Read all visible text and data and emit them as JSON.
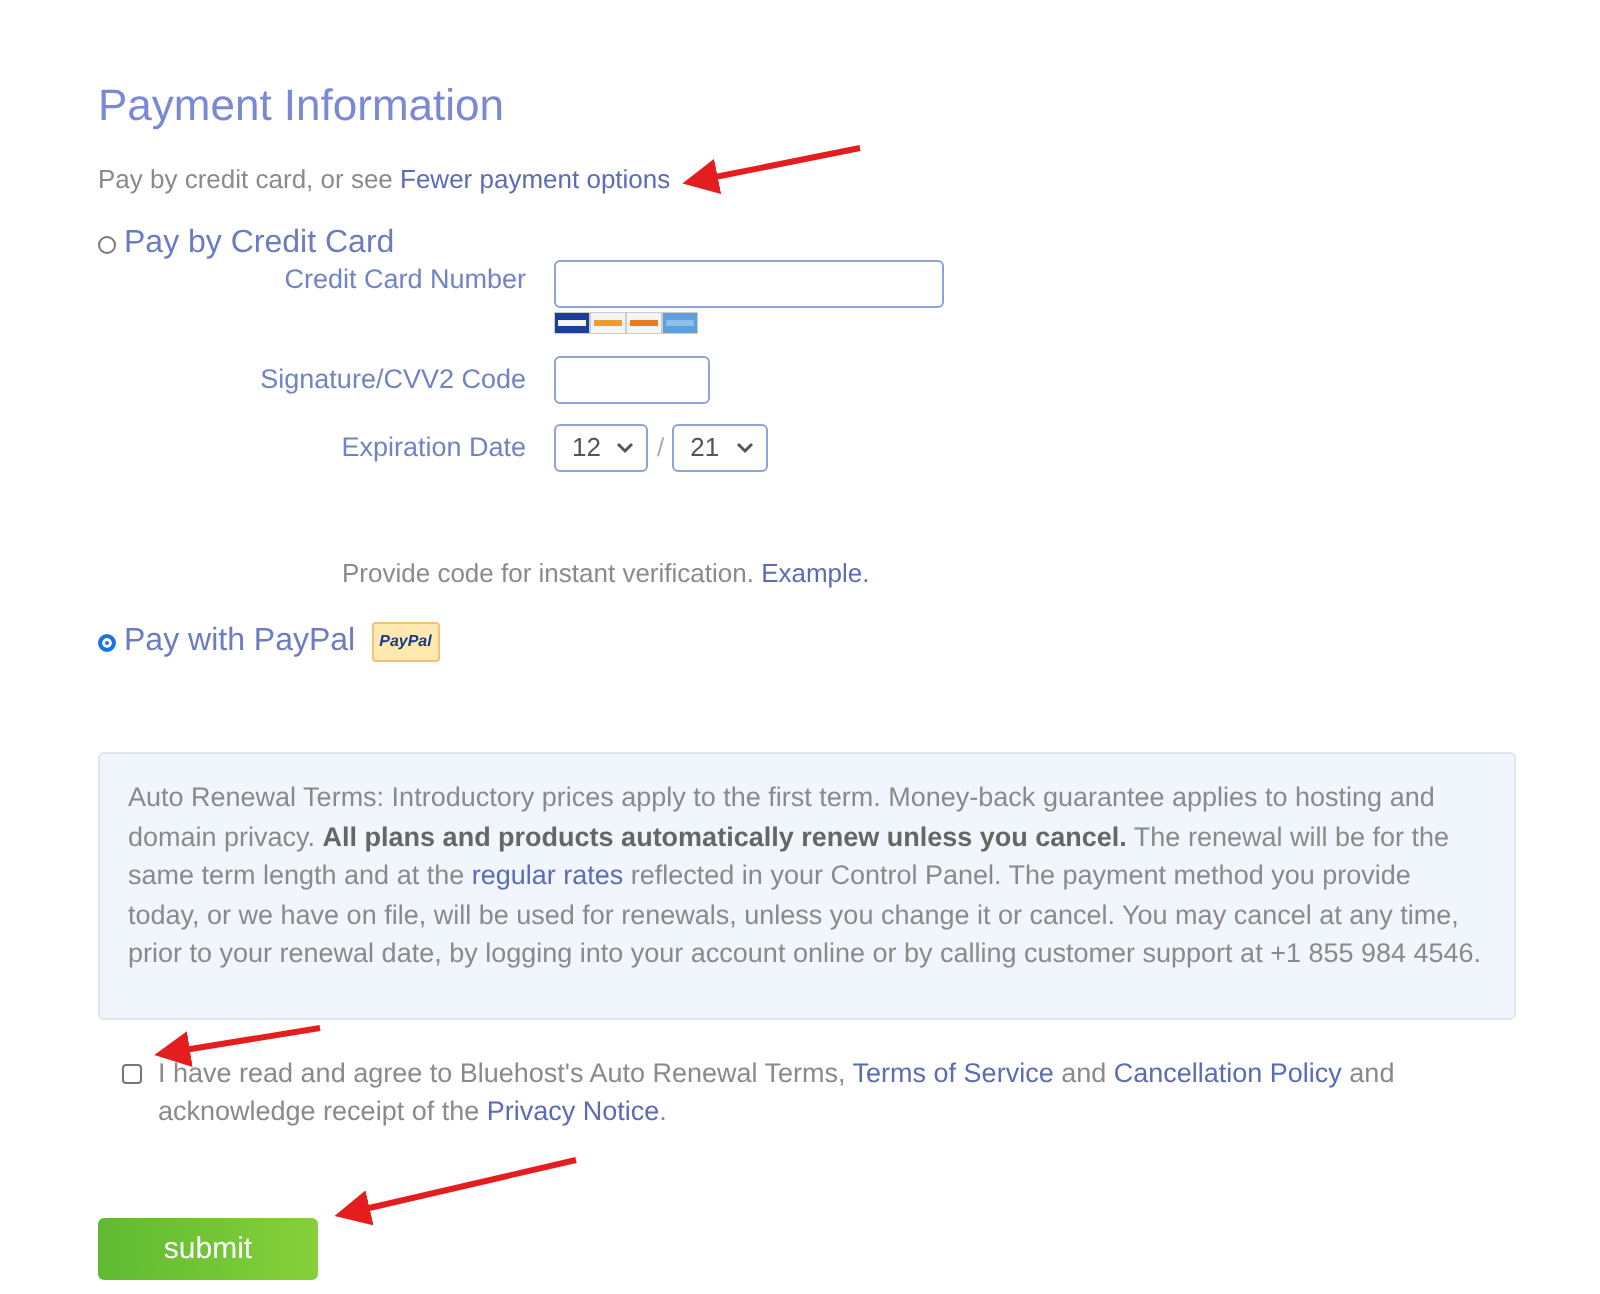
{
  "heading": "Payment Information",
  "intro": [
    {
      "text": "Pay by credit card, or see ",
      "link": false
    },
    {
      "text": "Fewer payment options",
      "link": true
    }
  ],
  "methods": [
    {
      "kind": "card",
      "label": "Pay by Credit Card",
      "selected": false,
      "fields": [
        {
          "kind": "text",
          "label": "Credit Card Number",
          "cards": true
        },
        {
          "kind": "short",
          "label": "Signature/CVV2 Code"
        },
        {
          "kind": "expiry",
          "label": "Expiration Date",
          "month": "12",
          "separator": "/",
          "year": "21"
        }
      ],
      "note": [
        {
          "text": "Provide code for instant verification. ",
          "link": false
        },
        {
          "text": "Example.",
          "link": true
        }
      ]
    },
    {
      "kind": "paypal",
      "label": "Pay with PayPal",
      "selected": true,
      "badge": "PayPal"
    }
  ],
  "terms": [
    {
      "text": "Auto Renewal Terms: Introductory prices apply to the first term. Money-back guarantee applies to hosting and domain privacy. **All plans and products automatically renew unless you cancel.** The renewal will be for the same term length and at the ",
      "link": false
    },
    {
      "text": "regular rates",
      "link": true
    },
    {
      "text": " reflected in your Control Panel. The payment method you provide today, or we have on file, will be used for renewals, unless you change it or cancel. You may cancel at any time, prior to your renewal date, by logging into your account online or by calling customer support at +1 855 984 4546.",
      "link": false
    }
  ],
  "agreement": {
    "checked": false,
    "segments": [
      {
        "text": "I have read and agree to Bluehost's Auto Renewal Terms, ",
        "link": false
      },
      {
        "text": "Terms of Service",
        "link": true
      },
      {
        "text": " and ",
        "link": false
      },
      {
        "text": "Cancellation Policy",
        "link": true
      },
      {
        "text": " and acknowledge receipt of the ",
        "link": false
      },
      {
        "text": "Privacy Notice",
        "link": true
      },
      {
        "text": ".",
        "link": false
      }
    ]
  },
  "submit": "submit"
}
